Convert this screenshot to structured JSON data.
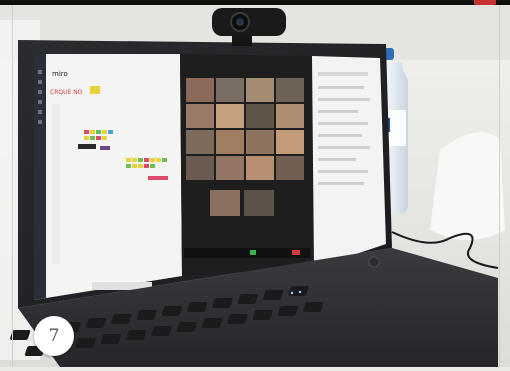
{
  "photo": {
    "subject": "laptop-video-meeting-photo",
    "badge_number": "7"
  },
  "screen": {
    "whiteboard_app_logo": "miro",
    "whiteboard_heading": "CRQUE NO",
    "participant_count_visible": 16
  },
  "palette": {
    "desk": "#ebebe8",
    "laptop_body": "#2a2a2d",
    "keyboard_keys": "#1c1c1f",
    "meeting_bg": "#1e1e1e",
    "whiteboard_bg": "#f4f4f2",
    "sticky_yellow": "#e8d23a",
    "sticky_green": "#6bbf59",
    "sticky_pink": "#e04a6a"
  }
}
